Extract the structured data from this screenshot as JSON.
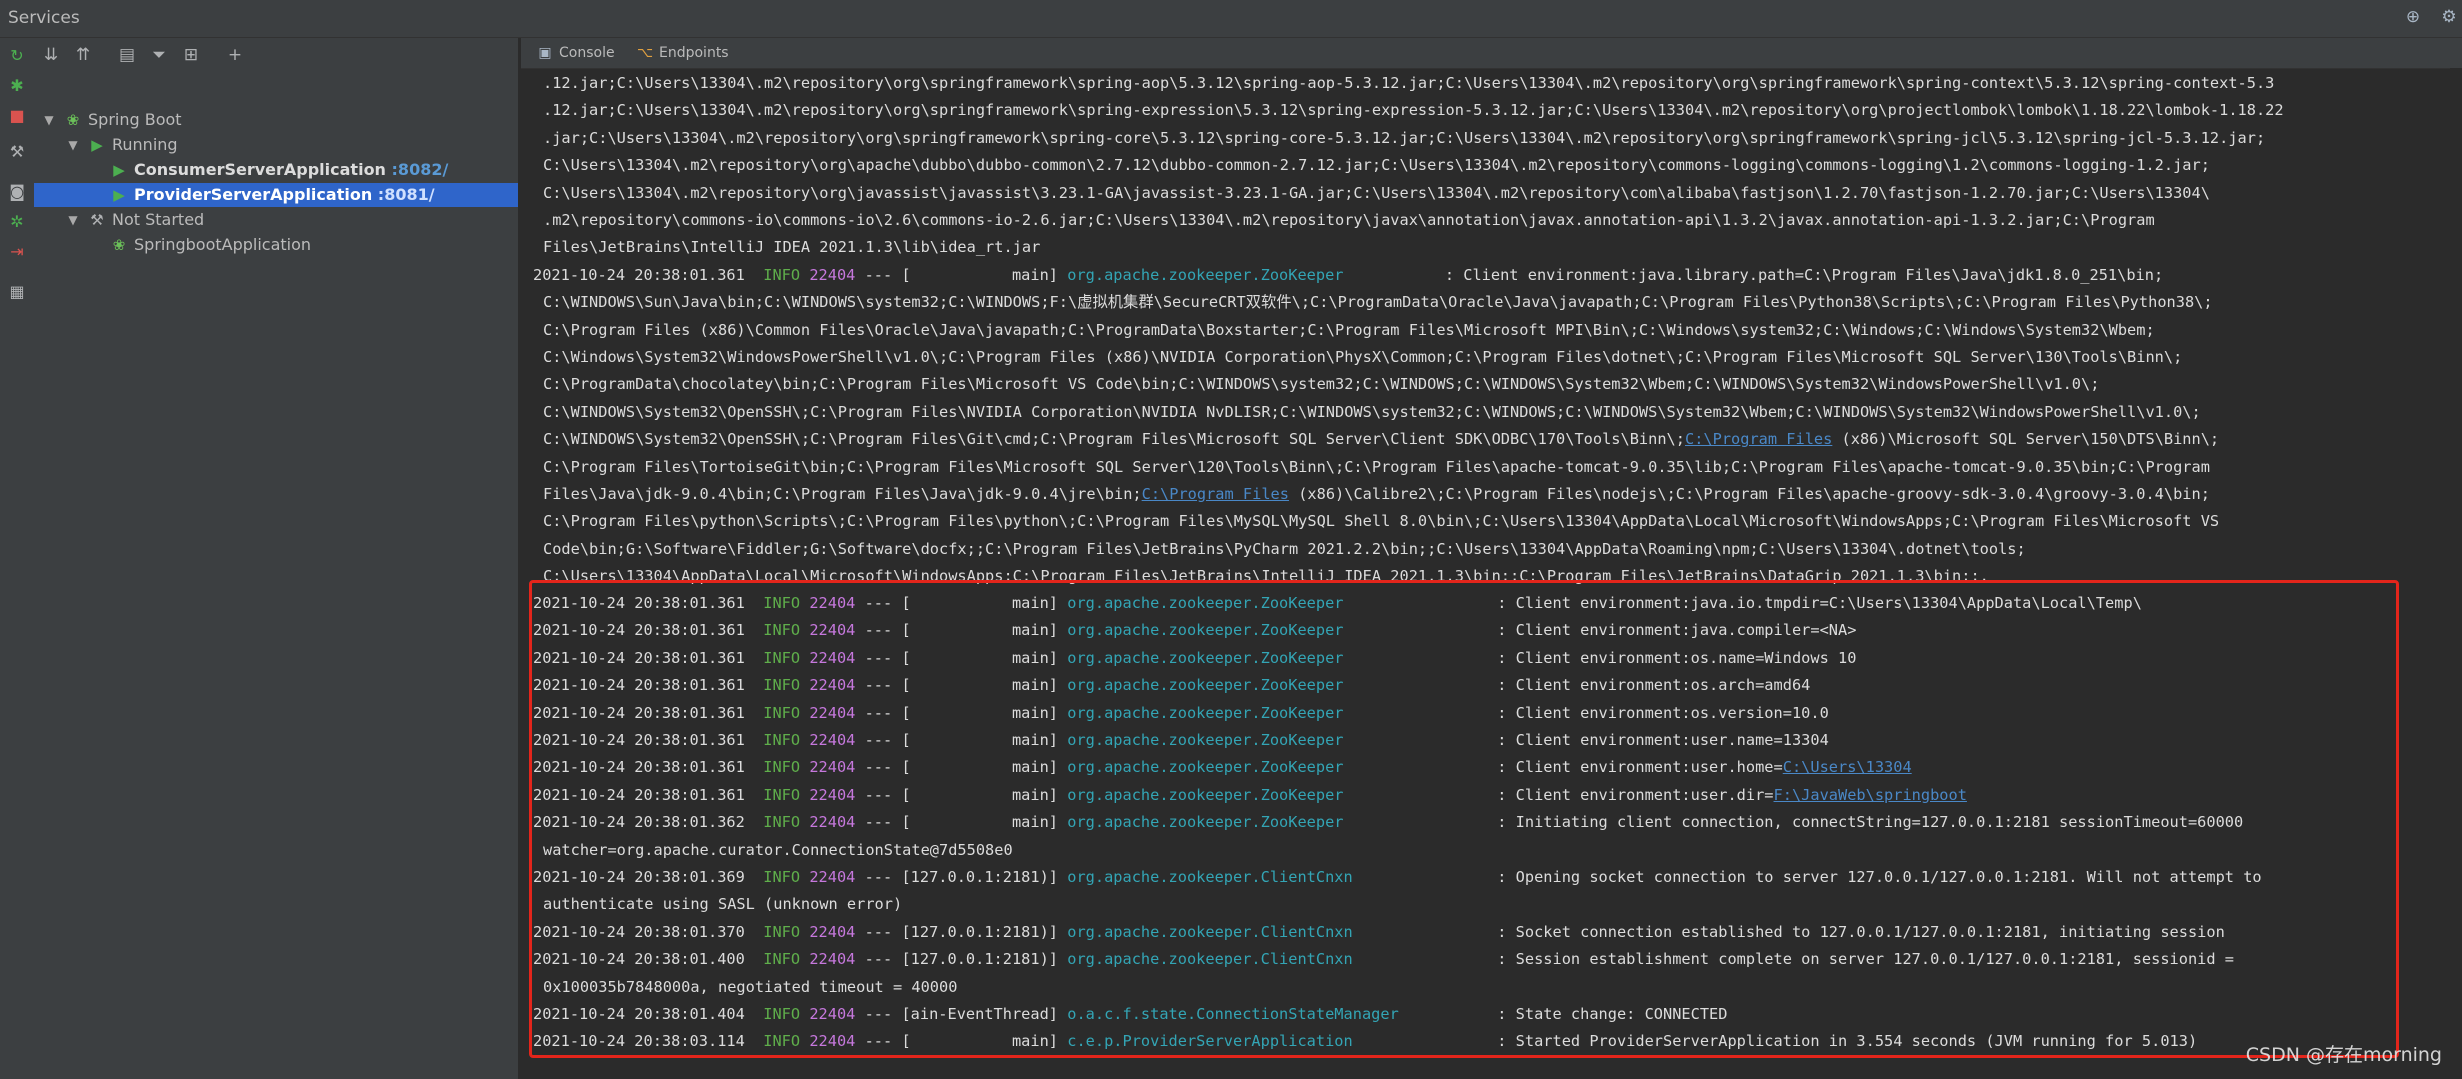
{
  "window": {
    "title": "Services"
  },
  "tree_toolbar": {
    "icons": [
      "expand-all-icon",
      "collapse-all-icon",
      "group-by-icon",
      "filter-icon",
      "layout-icon",
      "add-service-icon"
    ]
  },
  "tree": {
    "spring_boot": "Spring Boot",
    "running": "Running",
    "consumer_app": "ConsumerServerApplication",
    "consumer_port": ":8082/",
    "provider_app": "ProviderServerApplication",
    "provider_port": ":8081/",
    "not_started": "Not Started",
    "springboot_app": "SpringbootApplication"
  },
  "tabs": {
    "console": "Console",
    "endpoints": "Endpoints"
  },
  "colors": {
    "selection": "#2f65ca",
    "highlight_box": "#e3251b",
    "info": "#5fae4b",
    "pid": "#c678dd",
    "logger": "#33a5b5",
    "link": "#4a88c7",
    "running": "#4caf50"
  },
  "log": {
    "classpath": [
      ".12.jar;C:\\Users\\13304\\.m2\\repository\\org\\springframework\\spring-aop\\5.3.12\\spring-aop-5.3.12.jar;C:\\Users\\13304\\.m2\\repository\\org\\springframework\\spring-context\\5.3.12\\spring-context-5.3",
      ".12.jar;C:\\Users\\13304\\.m2\\repository\\org\\springframework\\spring-expression\\5.3.12\\spring-expression-5.3.12.jar;C:\\Users\\13304\\.m2\\repository\\org\\projectlombok\\lombok\\1.18.22\\lombok-1.18.22",
      ".jar;C:\\Users\\13304\\.m2\\repository\\org\\springframework\\spring-core\\5.3.12\\spring-core-5.3.12.jar;C:\\Users\\13304\\.m2\\repository\\org\\springframework\\spring-jcl\\5.3.12\\spring-jcl-5.3.12.jar;",
      "C:\\Users\\13304\\.m2\\repository\\org\\apache\\dubbo\\dubbo-common\\2.7.12\\dubbo-common-2.7.12.jar;C:\\Users\\13304\\.m2\\repository\\commons-logging\\commons-logging\\1.2\\commons-logging-1.2.jar;",
      "C:\\Users\\13304\\.m2\\repository\\org\\javassist\\javassist\\3.23.1-GA\\javassist-3.23.1-GA.jar;C:\\Users\\13304\\.m2\\repository\\com\\alibaba\\fastjson\\1.2.70\\fastjson-1.2.70.jar;C:\\Users\\13304\\",
      ".m2\\repository\\commons-io\\commons-io\\2.6\\commons-io-2.6.jar;C:\\Users\\13304\\.m2\\repository\\javax\\annotation\\javax.annotation-api\\1.3.2\\javax.annotation-api-1.3.2.jar;C:\\Program",
      "Files\\JetBrains\\IntelliJ IDEA 2021.1.3\\lib\\idea_rt.jar"
    ],
    "library_path_entry": {
      "ts": "2021-10-24 20:38:01.361",
      "level": "INFO",
      "pid": "22404",
      "sep": "---",
      "thread": "[           main]",
      "logger": "org.apache.zookeeper.ZooKeeper",
      "msg": ": Client environment:java.library.path=C:\\Program Files\\Java\\jdk1.8.0_251\\bin;"
    },
    "library_path_cont": {
      "l1": "C:\\WINDOWS\\Sun\\Java\\bin;C:\\WINDOWS\\system32;C:\\WINDOWS;F:\\虚拟机集群\\SecureCRT双软件\\;C:\\ProgramData\\Oracle\\Java\\javapath;C:\\Program Files\\Python38\\Scripts\\;C:\\Program Files\\Python38\\;",
      "l2": "C:\\Program Files (x86)\\Common Files\\Oracle\\Java\\javapath;C:\\ProgramData\\Boxstarter;C:\\Program Files\\Microsoft MPI\\Bin\\;C:\\Windows\\system32;C:\\Windows;C:\\Windows\\System32\\Wbem;",
      "l3": "C:\\Windows\\System32\\WindowsPowerShell\\v1.0\\;C:\\Program Files (x86)\\NVIDIA Corporation\\PhysX\\Common;C:\\Program Files\\dotnet\\;C:\\Program Files\\Microsoft SQL Server\\130\\Tools\\Binn\\;",
      "l4": "C:\\ProgramData\\chocolatey\\bin;C:\\Program Files\\Microsoft VS Code\\bin;C:\\WINDOWS\\system32;C:\\WINDOWS;C:\\WINDOWS\\System32\\Wbem;C:\\WINDOWS\\System32\\WindowsPowerShell\\v1.0\\;",
      "l5": "C:\\WINDOWS\\System32\\OpenSSH\\;C:\\Program Files\\NVIDIA Corporation\\NVIDIA NvDLISR;C:\\WINDOWS\\system32;C:\\WINDOWS;C:\\WINDOWS\\System32\\Wbem;C:\\WINDOWS\\System32\\WindowsPowerShell\\v1.0\\;",
      "l6_a": "C:\\WINDOWS\\System32\\OpenSSH\\;C:\\Program Files\\Git\\cmd;C:\\Program Files\\Microsoft SQL Server\\Client SDK\\ODBC\\170\\Tools\\Binn\\;",
      "l6_link": "C:\\Program Files",
      "l6_b": " (x86)\\Microsoft SQL Server\\150\\DTS\\Binn\\;",
      "l7": "C:\\Program Files\\TortoiseGit\\bin;C:\\Program Files\\Microsoft SQL Server\\120\\Tools\\Binn\\;C:\\Program Files\\apache-tomcat-9.0.35\\lib;C:\\Program Files\\apache-tomcat-9.0.35\\bin;C:\\Program",
      "l8_a": "Files\\Java\\jdk-9.0.4\\bin;C:\\Program Files\\Java\\jdk-9.0.4\\jre\\bin;",
      "l8_link": "C:\\Program Files",
      "l8_b": " (x86)\\Calibre2\\;C:\\Program Files\\nodejs\\;C:\\Program Files\\apache-groovy-sdk-3.0.4\\groovy-3.0.4\\bin;",
      "l9": "C:\\Program Files\\python\\Scripts\\;C:\\Program Files\\python\\;C:\\Program Files\\MySQL\\MySQL Shell 8.0\\bin\\;C:\\Users\\13304\\AppData\\Local\\Microsoft\\WindowsApps;C:\\Program Files\\Microsoft VS",
      "l10": "Code\\bin;G:\\Software\\Fiddler;G:\\Software\\docfx;;C:\\Program Files\\JetBrains\\PyCharm 2021.2.2\\bin;;C:\\Users\\13304\\AppData\\Roaming\\npm;C:\\Users\\13304\\.dotnet\\tools;",
      "l11": "C:\\Users\\13304\\AppData\\Local\\Microsoft\\WindowsApps;C:\\Program Files\\JetBrains\\IntelliJ IDEA 2021.1.3\\bin;;C:\\Program Files\\JetBrains\\DataGrip 2021.1.3\\bin;;."
    },
    "entries": [
      {
        "ts": "2021-10-24 20:38:01.361",
        "level": "INFO",
        "pid": "22404",
        "sep": "---",
        "thread": "[           main]",
        "logger": "org.apache.zookeeper.ZooKeeper",
        "msg": ": Client environment:java.io.tmpdir=C:\\Users\\13304\\AppData\\Local\\Temp\\"
      },
      {
        "ts": "2021-10-24 20:38:01.361",
        "level": "INFO",
        "pid": "22404",
        "sep": "---",
        "thread": "[           main]",
        "logger": "org.apache.zookeeper.ZooKeeper",
        "msg": ": Client environment:java.compiler=<NA>"
      },
      {
        "ts": "2021-10-24 20:38:01.361",
        "level": "INFO",
        "pid": "22404",
        "sep": "---",
        "thread": "[           main]",
        "logger": "org.apache.zookeeper.ZooKeeper",
        "msg": ": Client environment:os.name=Windows 10"
      },
      {
        "ts": "2021-10-24 20:38:01.361",
        "level": "INFO",
        "pid": "22404",
        "sep": "---",
        "thread": "[           main]",
        "logger": "org.apache.zookeeper.ZooKeeper",
        "msg": ": Client environment:os.arch=amd64"
      },
      {
        "ts": "2021-10-24 20:38:01.361",
        "level": "INFO",
        "pid": "22404",
        "sep": "---",
        "thread": "[           main]",
        "logger": "org.apache.zookeeper.ZooKeeper",
        "msg": ": Client environment:os.version=10.0"
      },
      {
        "ts": "2021-10-24 20:38:01.361",
        "level": "INFO",
        "pid": "22404",
        "sep": "---",
        "thread": "[           main]",
        "logger": "org.apache.zookeeper.ZooKeeper",
        "msg": ": Client environment:user.name=13304"
      },
      {
        "ts": "2021-10-24 20:38:01.361",
        "level": "INFO",
        "pid": "22404",
        "sep": "---",
        "thread": "[           main]",
        "logger": "org.apache.zookeeper.ZooKeeper",
        "msg": ": Client environment:user.home=",
        "link": "C:\\Users\\13304"
      },
      {
        "ts": "2021-10-24 20:38:01.361",
        "level": "INFO",
        "pid": "22404",
        "sep": "---",
        "thread": "[           main]",
        "logger": "org.apache.zookeeper.ZooKeeper",
        "msg": ": Client environment:user.dir=",
        "link": "F:\\JavaWeb\\springboot"
      },
      {
        "ts": "2021-10-24 20:38:01.362",
        "level": "INFO",
        "pid": "22404",
        "sep": "---",
        "thread": "[           main]",
        "logger": "org.apache.zookeeper.ZooKeeper",
        "msg": ": Initiating client connection, connectString=127.0.0.1:2181 sessionTimeout=60000",
        "cont": "watcher=org.apache.curator.ConnectionState@7d5508e0"
      },
      {
        "ts": "2021-10-24 20:38:01.369",
        "level": "INFO",
        "pid": "22404",
        "sep": "---",
        "thread": "[127.0.0.1:2181)]",
        "logger": "org.apache.zookeeper.ClientCnxn",
        "msg": ": Opening socket connection to server 127.0.0.1/127.0.0.1:2181. Will not attempt to",
        "cont": "authenticate using SASL (unknown error)"
      },
      {
        "ts": "2021-10-24 20:38:01.370",
        "level": "INFO",
        "pid": "22404",
        "sep": "---",
        "thread": "[127.0.0.1:2181)]",
        "logger": "org.apache.zookeeper.ClientCnxn",
        "msg": ": Socket connection established to 127.0.0.1/127.0.0.1:2181, initiating session"
      },
      {
        "ts": "2021-10-24 20:38:01.400",
        "level": "INFO",
        "pid": "22404",
        "sep": "---",
        "thread": "[127.0.0.1:2181)]",
        "logger": "org.apache.zookeeper.ClientCnxn",
        "msg": ": Session establishment complete on server 127.0.0.1/127.0.0.1:2181, sessionid =",
        "cont": "0x100035b7848000a, negotiated timeout = 40000"
      },
      {
        "ts": "2021-10-24 20:38:01.404",
        "level": "INFO",
        "pid": "22404",
        "sep": "---",
        "thread": "[ain-EventThread]",
        "logger": "o.a.c.f.state.ConnectionStateManager",
        "msg": ": State change: CONNECTED"
      },
      {
        "ts": "2021-10-24 20:38:03.114",
        "level": "INFO",
        "pid": "22404",
        "sep": "---",
        "thread": "[           main]",
        "logger": "c.e.p.ProviderServerApplication",
        "msg": ": Started ProviderServerApplication in 3.554 seconds (JVM running for 5.013)"
      }
    ]
  },
  "watermark": "CSDN @存在morning"
}
